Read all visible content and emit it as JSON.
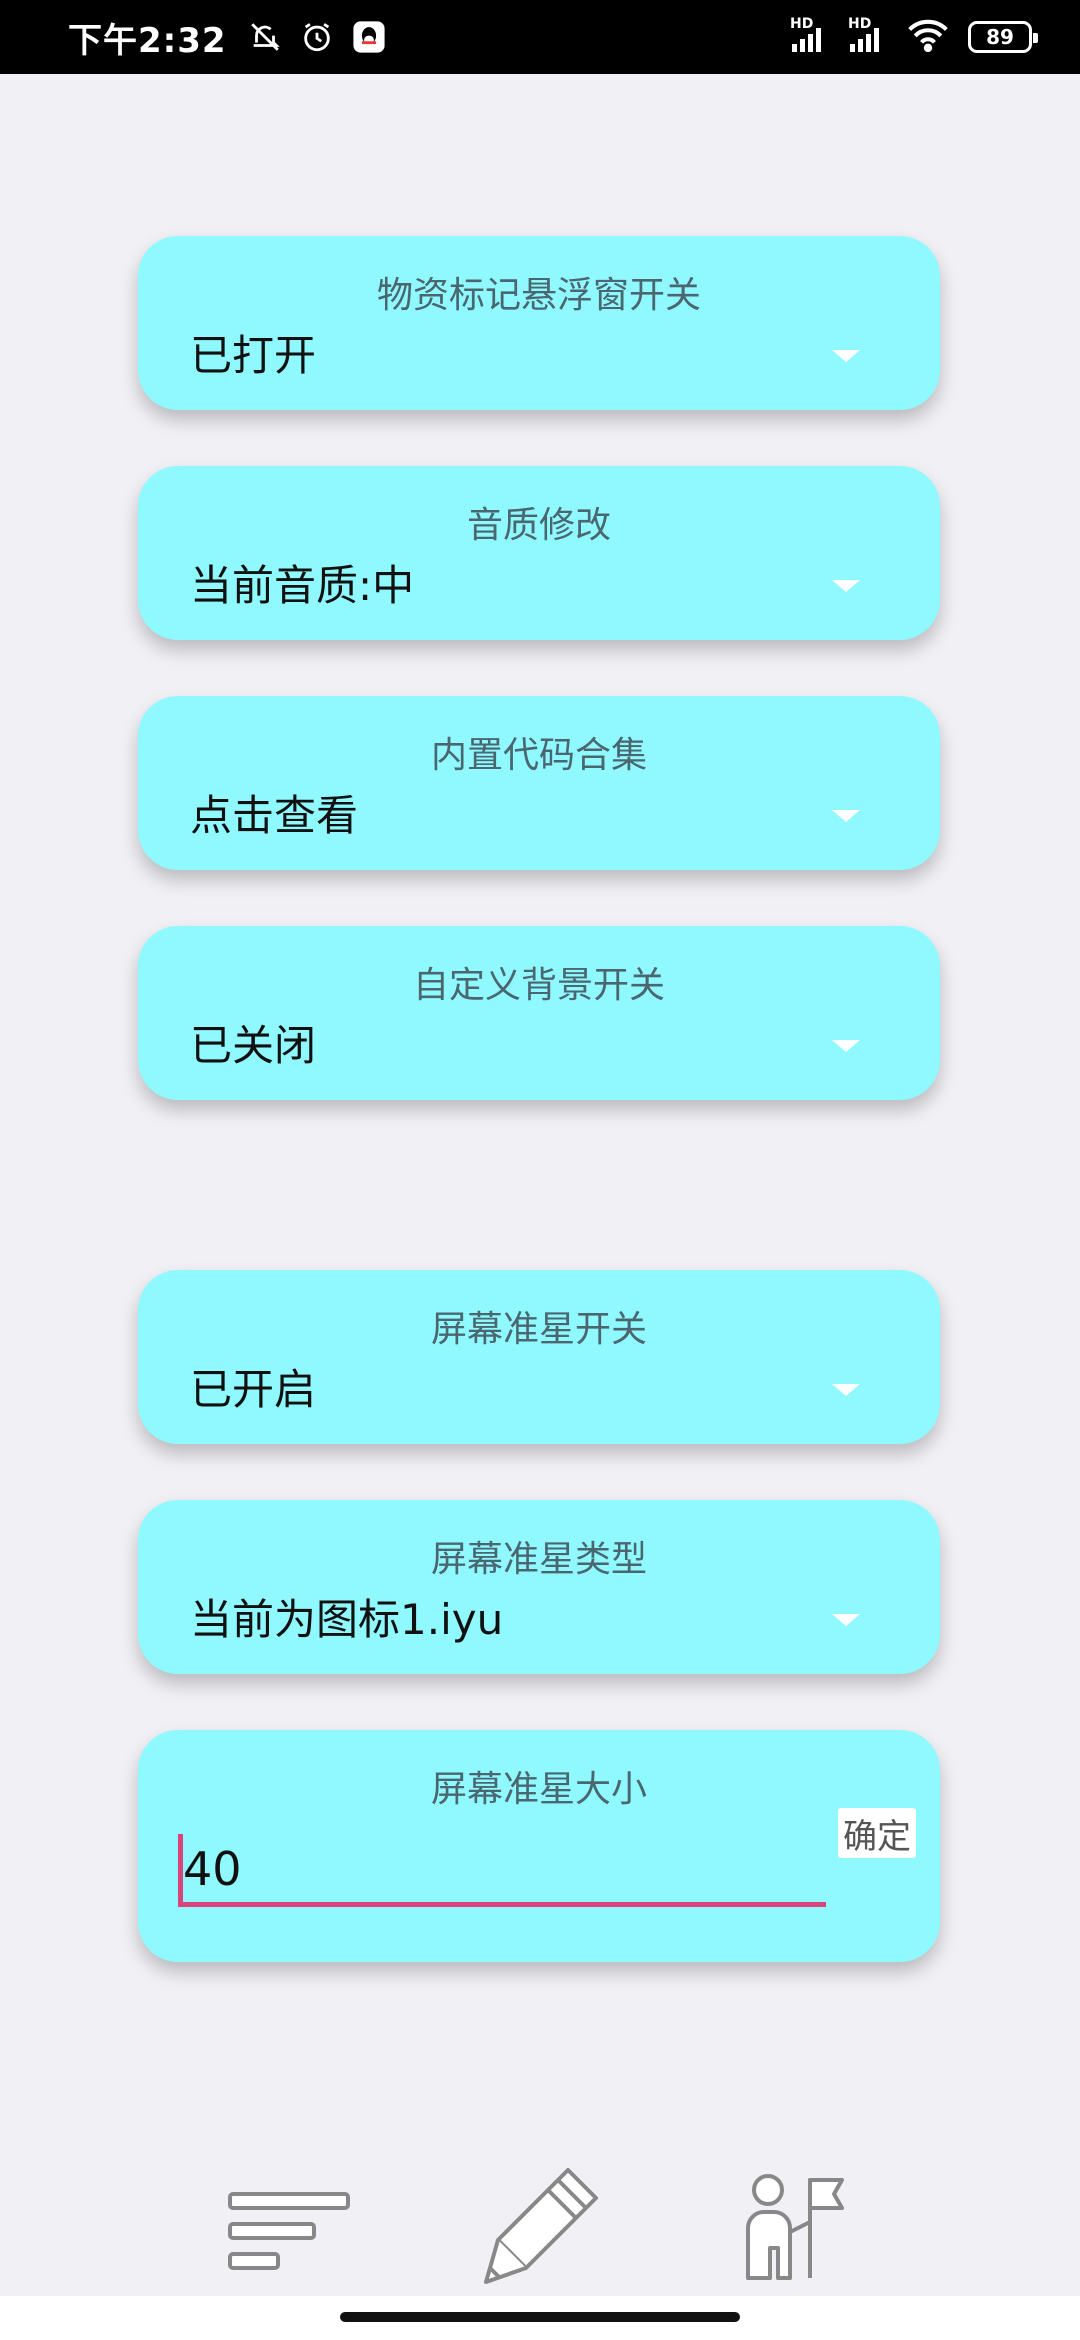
{
  "status_bar": {
    "time": "下午2:32",
    "left_icons": [
      "mute-icon",
      "alarm-icon",
      "qq-icon"
    ],
    "network_labels": [
      "HD",
      "HD"
    ],
    "battery": "89"
  },
  "group1": {
    "cards": [
      {
        "title": "物资标记悬浮窗开关",
        "value": "已打开"
      },
      {
        "title": "音质修改",
        "value": "当前音质:中"
      },
      {
        "title": "内置代码合集",
        "value": "点击查看"
      },
      {
        "title": "自定义背景开关",
        "value": "已关闭"
      }
    ]
  },
  "group2": {
    "cards": [
      {
        "title": "屏幕准星开关",
        "value": "已开启"
      },
      {
        "title": "屏幕准星类型",
        "value": "当前为图标1.iyu"
      }
    ],
    "size_card": {
      "title": "屏幕准星大小",
      "input_value": "40",
      "confirm_label": "确定"
    }
  },
  "bottom_nav": [
    "list-icon",
    "pencil-icon",
    "person-flag-icon"
  ]
}
